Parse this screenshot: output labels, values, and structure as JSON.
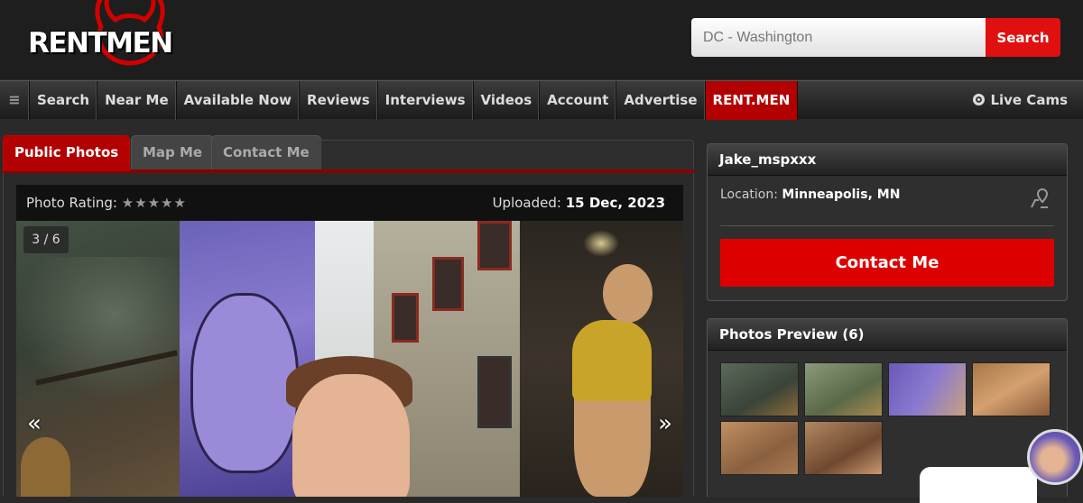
{
  "logo": {
    "text": "RENTMEN"
  },
  "search": {
    "value": "DC - Washington",
    "button_label": "Search"
  },
  "nav": {
    "menu_icon": "hamburger-icon",
    "items": [
      "Search",
      "Near Me",
      "Available Now",
      "Reviews",
      "Interviews",
      "Videos",
      "Account",
      "Advertise"
    ],
    "active_item": "RENT.MEN",
    "live_cams": "Live Cams",
    "live_cams_icon": "webcam-icon"
  },
  "tabs": {
    "public_photos": "Public Photos",
    "map_me": "Map Me",
    "contact_me": "Contact Me"
  },
  "photo": {
    "rating_label": "Photo Rating:",
    "rating_stars": "★★★★★",
    "uploaded_label": "Uploaded:",
    "uploaded_date": "15 Dec, 2023",
    "counter": "3 / 6",
    "prev": "«",
    "next": "»"
  },
  "profile": {
    "username": "Jake_mspxxx",
    "location_label": "Location:",
    "location_value": "Minneapolis, MN",
    "location_icon": "map-pin-icon",
    "contact_button": "Contact Me"
  },
  "preview": {
    "title": "Photos Preview (6)",
    "count": 6
  },
  "colors": {
    "accent": "#d00000",
    "nav_active": "#b30000",
    "background": "#2a2a2a"
  }
}
